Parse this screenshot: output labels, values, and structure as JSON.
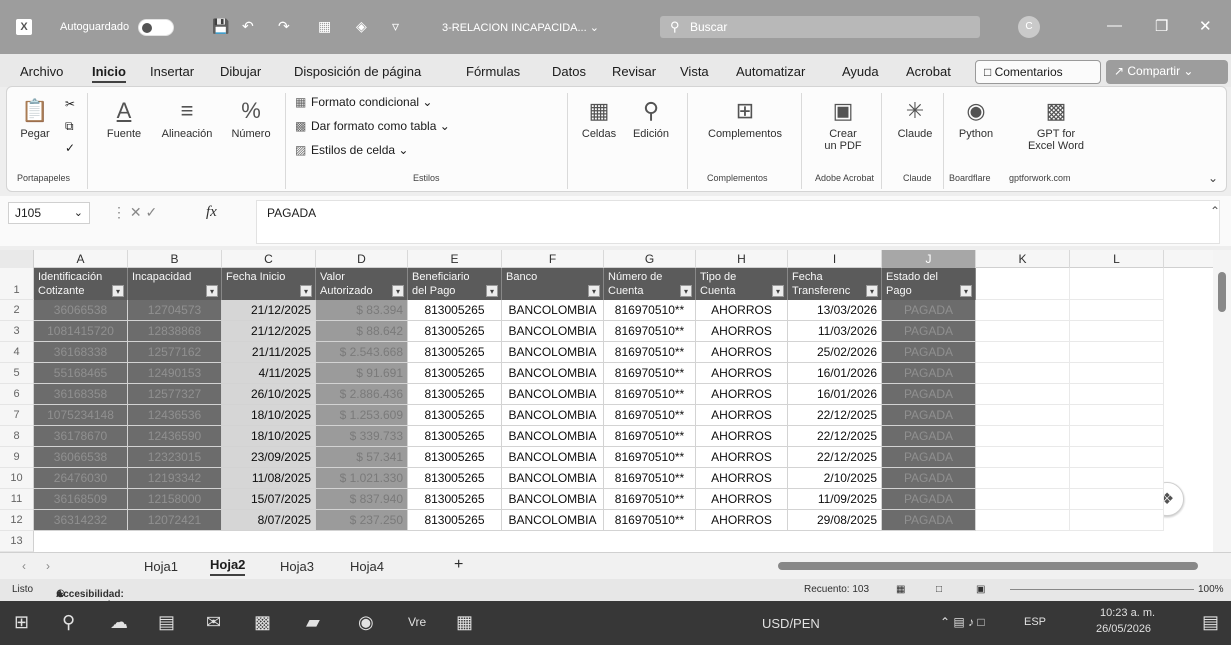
{
  "titlebar": {
    "app_icon": "excel-icon",
    "autosave_label": "Autoguardado",
    "autosave_state": "",
    "document_title": "3-RELACION INCAPACIDA... ⌄",
    "search_placeholder": "Buscar"
  },
  "menu": {
    "tabs": [
      "Archivo",
      "Inicio",
      "Insertar",
      "Dibujar",
      "Disposición de página",
      "Fórmulas",
      "Datos",
      "Revisar",
      "Vista",
      "Automatizar",
      "Ayuda",
      "Acrobat"
    ],
    "comments_label": "Comentarios",
    "share_label": "Compartir"
  },
  "ribbon": {
    "paste": "Pegar",
    "clipboard_group": "Portapapeles",
    "font": "Fuente",
    "alignment": "Alineación",
    "number": "Número",
    "conditional_format": "Formato condicional",
    "format_as_table": "Dar formato como tabla",
    "cell_styles": "Estilos de celda",
    "styles_group": "Estilos",
    "cells": "Celdas",
    "editing": "Edición",
    "addins": "Complementos",
    "addins_group": "Complementos",
    "create_pdf_1": "Crear",
    "create_pdf_2": "un PDF",
    "acrobat_group": "Adobe Acrobat",
    "claude": "Claude",
    "claude_group": "Claude",
    "python": "Python",
    "python_group": "Boardflare",
    "gpt_1": "GPT for",
    "gpt_2": "Excel Word",
    "gpt_group": "gptforwork.com"
  },
  "formula_bar": {
    "name_box": "J105",
    "formula": "PAGADA"
  },
  "sheet": {
    "columns": [
      "A",
      "B",
      "C",
      "D",
      "E",
      "F",
      "G",
      "H",
      "I",
      "J",
      "K",
      "L"
    ],
    "headers": [
      [
        "Identificación",
        "Cotizante"
      ],
      [
        "Incapacidad",
        ""
      ],
      [
        "Fecha Inicio",
        ""
      ],
      [
        "Valor",
        "Autorizado"
      ],
      [
        "Beneficiario",
        "del Pago"
      ],
      [
        "Banco",
        ""
      ],
      [
        "Número de",
        "Cuenta"
      ],
      [
        "Tipo de",
        "Cuenta"
      ],
      [
        "Fecha",
        "Transferenc"
      ],
      [
        "Estado del",
        "Pago"
      ]
    ],
    "row_numbers": [
      "1",
      "2",
      "3",
      "4",
      "5",
      "6",
      "7",
      "8",
      "9",
      "10",
      "11",
      "12",
      "13"
    ],
    "rows": [
      [
        "36066538",
        "12704573",
        "21/12/2025",
        "$ 83.394",
        "813005265",
        "BANCOLOMBIA",
        "816970510**",
        "AHORROS",
        "13/03/2026",
        "PAGADA"
      ],
      [
        "1081415720",
        "12838868",
        "21/12/2025",
        "$ 88.642",
        "813005265",
        "BANCOLOMBIA",
        "816970510**",
        "AHORROS",
        "11/03/2026",
        "PAGADA"
      ],
      [
        "36168338",
        "12577162",
        "21/11/2025",
        "$ 2.543.668",
        "813005265",
        "BANCOLOMBIA",
        "816970510**",
        "AHORROS",
        "25/02/2026",
        "PAGADA"
      ],
      [
        "55168465",
        "12490153",
        "4/11/2025",
        "$ 91.691",
        "813005265",
        "BANCOLOMBIA",
        "816970510**",
        "AHORROS",
        "16/01/2026",
        "PAGADA"
      ],
      [
        "36168358",
        "12577327",
        "26/10/2025",
        "$ 2.886.436",
        "813005265",
        "BANCOLOMBIA",
        "816970510**",
        "AHORROS",
        "16/01/2026",
        "PAGADA"
      ],
      [
        "1075234148",
        "12436536",
        "18/10/2025",
        "$ 1.253.609",
        "813005265",
        "BANCOLOMBIA",
        "816970510**",
        "AHORROS",
        "22/12/2025",
        "PAGADA"
      ],
      [
        "36178670",
        "12436590",
        "18/10/2025",
        "$ 339.733",
        "813005265",
        "BANCOLOMBIA",
        "816970510**",
        "AHORROS",
        "22/12/2025",
        "PAGADA"
      ],
      [
        "36066538",
        "12323015",
        "23/09/2025",
        "$ 57.341",
        "813005265",
        "BANCOLOMBIA",
        "816970510**",
        "AHORROS",
        "22/12/2025",
        "PAGADA"
      ],
      [
        "26476030",
        "12193342",
        "11/08/2025",
        "$ 1.021.330",
        "813005265",
        "BANCOLOMBIA",
        "816970510**",
        "AHORROS",
        "2/10/2025",
        "PAGADA"
      ],
      [
        "36168509",
        "12158000",
        "15/07/2025",
        "$ 837.940",
        "813005265",
        "BANCOLOMBIA",
        "816970510**",
        "AHORROS",
        "11/09/2025",
        "PAGADA"
      ],
      [
        "36314232",
        "12072421",
        "8/07/2025",
        "$ 237.250",
        "813005265",
        "BANCOLOMBIA",
        "816970510**",
        "AHORROS",
        "29/08/2025",
        "PAGADA"
      ]
    ]
  },
  "sheet_tabs": [
    "Hoja1",
    "Hoja2",
    "Hoja3",
    "Hoja4"
  ],
  "add_sheet": "+",
  "status": {
    "ready": "Listo",
    "accessibility": "Accesibilidad: es necesario investigar",
    "count": "Recuento: 103",
    "zoom": "100%"
  },
  "taskbar": {
    "ticker": "USD/PEN",
    "lang": "ESP",
    "time": "10:23 a. m.",
    "date": "26/05/2026"
  }
}
